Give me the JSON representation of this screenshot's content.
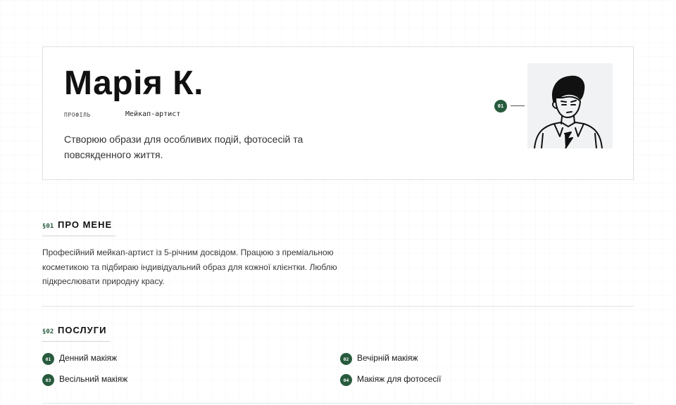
{
  "profile": {
    "name": "Марія К.",
    "meta_label": "ПРОФІЛЬ",
    "meta_value": "Мейкап-артист",
    "tagline": "Створюю образи для особливих подій, фотосесій та повсякденного життя.",
    "avatar_pin": "01",
    "avatar_icon": "person-illustration"
  },
  "about": {
    "number": "§01",
    "title": "ПРО МЕНЕ",
    "text": "Професійний мейкап-артист із 5-річним досвідом. Працюю з преміальною косметикою та підбираю індивідуальний образ для кожної клієнтки. Люблю підкреслювати природну красу."
  },
  "services": {
    "number": "§02",
    "title": "ПОСЛУГИ",
    "items": [
      {
        "num": "01",
        "label": "Денний макіяж"
      },
      {
        "num": "02",
        "label": "Вечірній макіяж"
      },
      {
        "num": "03",
        "label": "Весільний макіяж"
      },
      {
        "num": "04",
        "label": "Макіяж для фотосесії"
      }
    ]
  },
  "colors": {
    "accent": "#285b3e",
    "border": "#dde2e0",
    "text": "#1a1a1a"
  }
}
